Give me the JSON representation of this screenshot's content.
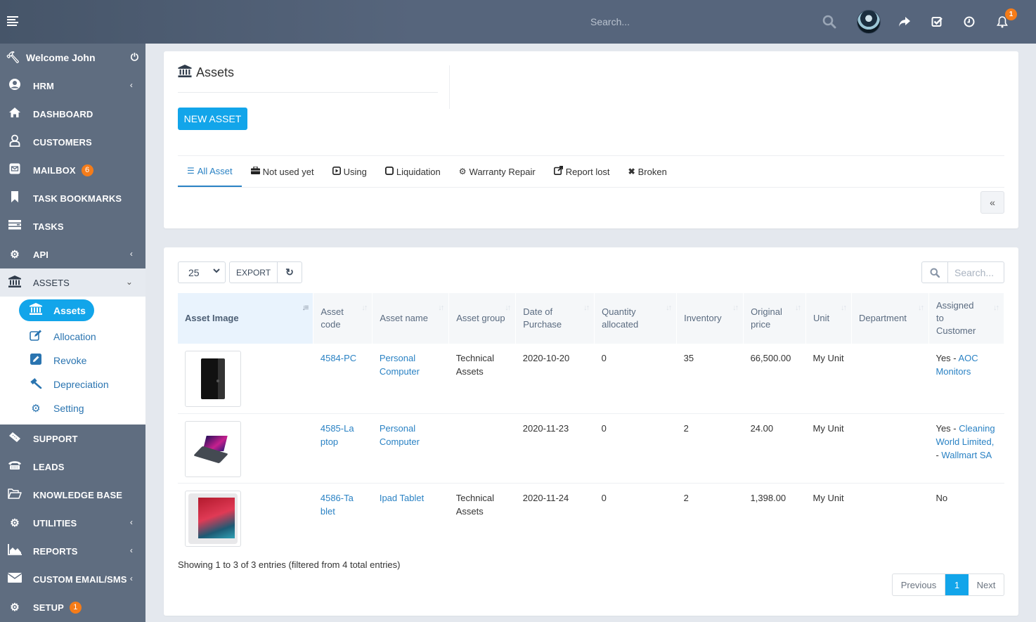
{
  "topbar": {
    "search_placeholder": "Search...",
    "notification_count": "1",
    "icons": [
      "menu-icon",
      "search-icon",
      "avatar",
      "share-icon",
      "checkbox-icon",
      "clock-icon",
      "bell-icon"
    ]
  },
  "sidebar": {
    "welcome": "Welcome John",
    "items": [
      {
        "label": "HRM",
        "icon": "user-circle-icon",
        "chevron": "‹"
      },
      {
        "label": "DASHBOARD",
        "icon": "home-icon"
      },
      {
        "label": "CUSTOMERS",
        "icon": "user-icon"
      },
      {
        "label": "MAILBOX",
        "icon": "envelope-square-icon",
        "badge": "6"
      },
      {
        "label": "TASK BOOKMARKS",
        "icon": "bookmark-icon"
      },
      {
        "label": "TASKS",
        "icon": "tasks-icon"
      },
      {
        "label": "API",
        "icon": "cogs-icon",
        "chevron": "‹"
      },
      {
        "label": "ASSETS",
        "icon": "bank-icon",
        "chevron": "⌄"
      },
      {
        "label": "SUPPORT",
        "icon": "ticket-icon"
      },
      {
        "label": "LEADS",
        "icon": "phone-icon"
      },
      {
        "label": "KNOWLEDGE BASE",
        "icon": "folder-open-icon"
      },
      {
        "label": "UTILITIES",
        "icon": "cogs-icon",
        "chevron": "‹"
      },
      {
        "label": "REPORTS",
        "icon": "area-chart-icon",
        "chevron": "‹"
      },
      {
        "label": "CUSTOM EMAIL/SMS",
        "icon": "envelope-icon",
        "chevron": "‹"
      },
      {
        "label": "SETUP",
        "icon": "gear-icon",
        "badge": "1"
      }
    ],
    "assets_submenu": [
      {
        "label": "Assets",
        "icon": "bank-icon"
      },
      {
        "label": "Allocation",
        "icon": "edit-icon"
      },
      {
        "label": "Revoke",
        "icon": "pencil-square-icon"
      },
      {
        "label": "Depreciation",
        "icon": "gavel-icon"
      },
      {
        "label": "Setting",
        "icon": "cogs-icon"
      }
    ]
  },
  "header": {
    "title": "Assets",
    "new_button": "NEW ASSET",
    "tabs": [
      {
        "label": "All Asset",
        "icon": "list-icon"
      },
      {
        "label": "Not used yet",
        "icon": "briefcase-icon"
      },
      {
        "label": "Using",
        "icon": "play-square-icon"
      },
      {
        "label": "Liquidation",
        "icon": "square-icon"
      },
      {
        "label": "Warranty Repair",
        "icon": "gear-icon"
      },
      {
        "label": "Report lost",
        "icon": "external-link-icon"
      },
      {
        "label": "Broken",
        "icon": "close-icon"
      }
    ],
    "collapse_label": "«"
  },
  "table": {
    "page_length": "25",
    "export_label": "EXPORT",
    "search_placeholder": "Search...",
    "columns": [
      "Asset Image",
      "Asset code",
      "Asset name",
      "Asset group",
      "Date of Purchase",
      "Quantity allocated",
      "Inventory",
      "Original price",
      "Unit",
      "Department",
      "Assigned to Customer"
    ],
    "rows": [
      {
        "image": "desktop-pc",
        "code": "4584-PC",
        "name": "Personal Computer",
        "group": "Technical Assets",
        "date": "2020-10-20",
        "qty": "0",
        "inventory": "35",
        "price": "66,500.00",
        "unit": "My Unit",
        "department": "",
        "assigned_prefix": "Yes - ",
        "assigned_links": [
          "AOC Monitors"
        ]
      },
      {
        "image": "laptop",
        "code": "4585-Laptop",
        "name": "Personal Computer",
        "group": "",
        "date": "2020-11-23",
        "qty": "0",
        "inventory": "2",
        "price": "24.00",
        "unit": "My Unit",
        "department": "",
        "assigned_prefix": "Yes - ",
        "assigned_links": [
          "Cleaning World Limited,",
          "Wallmart SA"
        ]
      },
      {
        "image": "tablet",
        "code": "4586-Tablet",
        "name": "Ipad Tablet",
        "group": "Technical Assets",
        "date": "2020-11-24",
        "qty": "0",
        "inventory": "2",
        "price": "1,398.00",
        "unit": "My Unit",
        "department": "",
        "assigned_prefix": "No",
        "assigned_links": []
      }
    ],
    "info": "Showing 1 to 3 of 3 entries (filtered from 4 total entries)",
    "pagination": {
      "previous": "Previous",
      "current": "1",
      "next": "Next"
    }
  }
}
